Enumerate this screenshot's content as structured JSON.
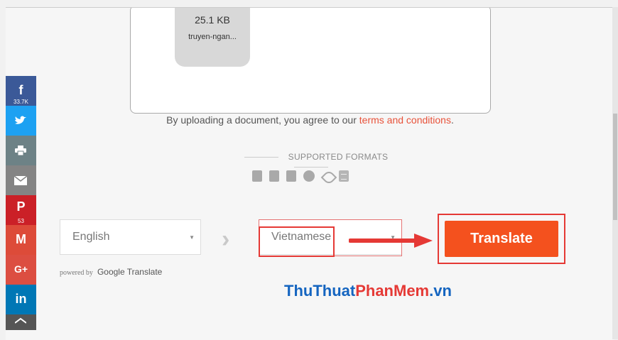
{
  "upload": {
    "file_size": "25.1 KB",
    "file_name": "truyen-ngan..."
  },
  "disclaimer": {
    "text_before": "By uploading a document, you agree to our ",
    "link": "terms and conditions",
    "text_after": "."
  },
  "formats": {
    "title": "SUPPORTED FORMATS",
    "icons": [
      "word-icon",
      "powerpoint-icon",
      "excel-icon",
      "openoffice-icon",
      "pdf-icon",
      "text-doc-icon"
    ]
  },
  "translator": {
    "source_language": "English",
    "target_language": "Vietnamese",
    "translate_label": "Translate",
    "powered_by": "powered by",
    "google_translate": "Google Translate"
  },
  "share": {
    "facebook_count": "33.7K",
    "pinterest_count": "53"
  },
  "watermark": {
    "part1": "ThuThuat",
    "part2": "PhanMem",
    "part3": ".vn"
  },
  "colors": {
    "accent": "#f4511e",
    "link": "#e8523a",
    "highlight": "#e53935"
  }
}
